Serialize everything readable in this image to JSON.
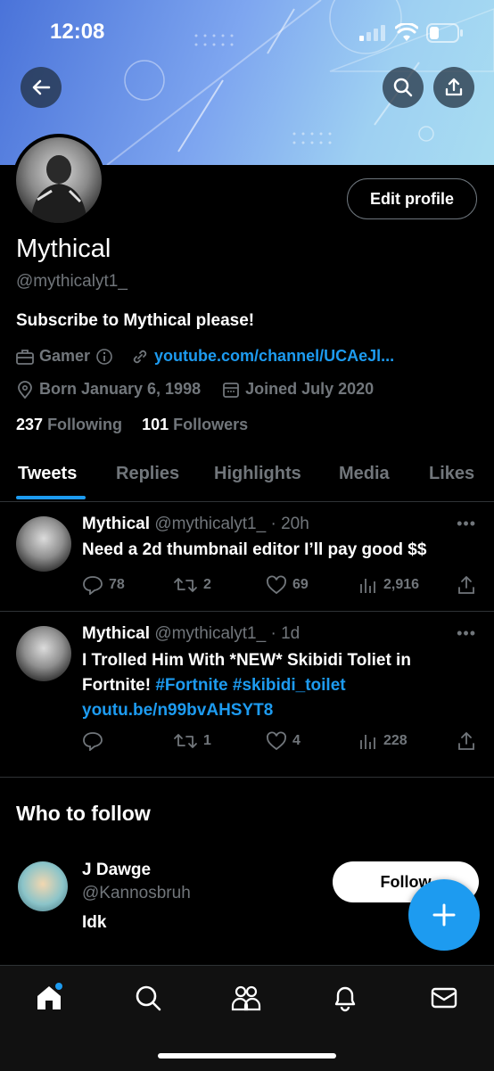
{
  "status": {
    "time": "12:08"
  },
  "profile": {
    "name": "Mythical",
    "handle": "@mythicalyt1_",
    "edit_label": "Edit profile",
    "bio": "Subscribe to Mythical please!",
    "category": "Gamer",
    "link": "youtube.com/channel/UCAeJl...",
    "born": "Born January 6, 1998",
    "joined": "Joined July 2020",
    "following_count": "237",
    "following_label": "Following",
    "followers_count": "101",
    "followers_label": "Followers"
  },
  "tabs": [
    "Tweets",
    "Replies",
    "Highlights",
    "Media",
    "Likes"
  ],
  "tweets": [
    {
      "name": "Mythical",
      "handle_time": "@mythicalyt1_ · 20h",
      "text": "Need a 2d thumbnail editor I’ll pay good $$",
      "replies": "78",
      "retweets": "2",
      "likes": "69",
      "views": "2,916"
    },
    {
      "name": "Mythical",
      "handle_time": "@mythicalyt1_ · 1d",
      "text_plain": "I Trolled Him With *NEW* Skibidi Toliet in Fortnite! ",
      "hashtag1": "#Fortnite",
      "hashtag2": "#skibidi_toilet",
      "link": "youtu.be/n99bvAHSYT8",
      "replies": "",
      "retweets": "1",
      "likes": "4",
      "views": "228"
    }
  ],
  "who_to_follow": {
    "title": "Who to follow",
    "user": {
      "name": "J Dawge",
      "handle": "@Kannosbruh",
      "bio": "Idk"
    },
    "follow_label": "Follow"
  },
  "colors": {
    "accent": "#1d9bf0",
    "muted": "#71767b",
    "bg": "#000000"
  }
}
